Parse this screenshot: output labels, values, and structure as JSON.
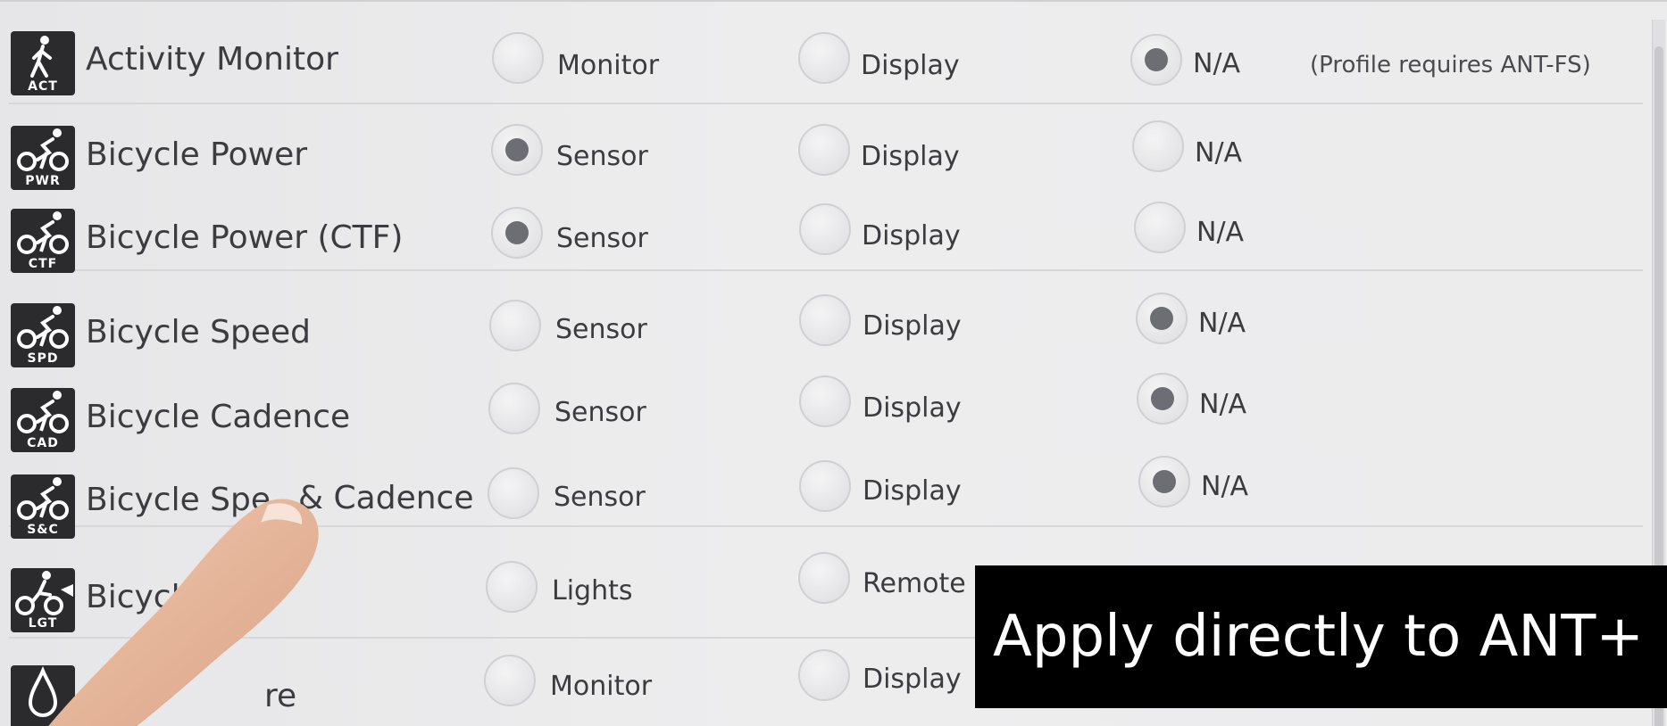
{
  "profiles": [
    {
      "name": "Activity Monitor",
      "tag": "ACT",
      "icon": "walking-person-icon",
      "options": [
        {
          "label": "Monitor",
          "checked": false
        },
        {
          "label": "Display",
          "checked": false
        },
        {
          "label": "N/A",
          "checked": true
        }
      ],
      "note": "(Profile requires ANT-FS)"
    },
    {
      "name": "Bicycle Power",
      "tag": "PWR",
      "icon": "bicycle-icon",
      "options": [
        {
          "label": "Sensor",
          "checked": true
        },
        {
          "label": "Display",
          "checked": false
        },
        {
          "label": "N/A",
          "checked": false
        }
      ]
    },
    {
      "name": "Bicycle Power (CTF)",
      "tag": "CTF",
      "icon": "bicycle-icon",
      "options": [
        {
          "label": "Sensor",
          "checked": true
        },
        {
          "label": "Display",
          "checked": false
        },
        {
          "label": "N/A",
          "checked": false
        }
      ]
    },
    {
      "name": "Bicycle Speed",
      "tag": "SPD",
      "icon": "bicycle-icon",
      "options": [
        {
          "label": "Sensor",
          "checked": false
        },
        {
          "label": "Display",
          "checked": false
        },
        {
          "label": "N/A",
          "checked": true
        }
      ]
    },
    {
      "name": "Bicycle Cadence",
      "tag": "CAD",
      "icon": "bicycle-icon",
      "options": [
        {
          "label": "Sensor",
          "checked": false
        },
        {
          "label": "Display",
          "checked": false
        },
        {
          "label": "N/A",
          "checked": true
        }
      ]
    },
    {
      "name": "Bicycle Spe",
      "name_tail": "& Cadence",
      "tag": "S&C",
      "icon": "bicycle-icon",
      "options": [
        {
          "label": "Sensor",
          "checked": false
        },
        {
          "label": "Display",
          "checked": false
        },
        {
          "label": "N/A",
          "checked": true
        }
      ]
    },
    {
      "name": "Bicycl",
      "tag": "LGT",
      "icon": "bicycle-light-icon",
      "options": [
        {
          "label": "Lights",
          "checked": false
        },
        {
          "label": "Remote",
          "checked": false
        }
      ]
    },
    {
      "name": "re",
      "tag": "",
      "icon": "water-drop-icon",
      "options": [
        {
          "label": "Monitor",
          "checked": false
        },
        {
          "label": "Display",
          "checked": false
        }
      ]
    }
  ],
  "overlay_caption": "Apply directly to ANT+"
}
